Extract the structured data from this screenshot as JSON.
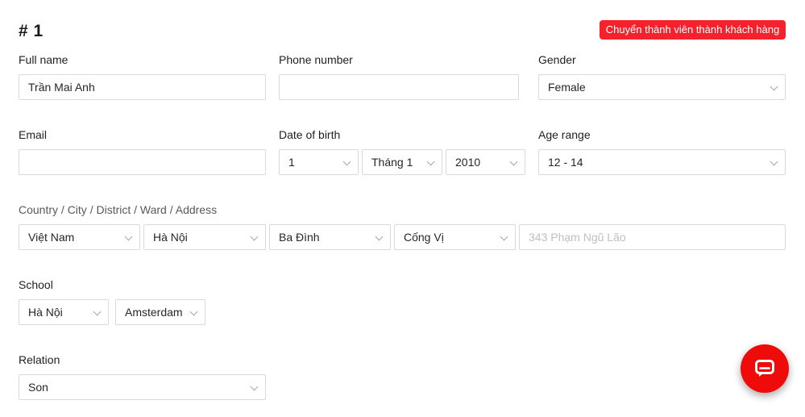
{
  "header": {
    "title": "# 1",
    "convert_label": "Chuyển thành viên thành khách hàng"
  },
  "form": {
    "full_name": {
      "label": "Full name",
      "value": "Trần Mai Anh"
    },
    "phone": {
      "label": "Phone number",
      "value": ""
    },
    "gender": {
      "label": "Gender",
      "value": "Female"
    },
    "email": {
      "label": "Email",
      "value": ""
    },
    "dob": {
      "label": "Date of birth",
      "day": "1",
      "month": "Tháng 1",
      "year": "2010"
    },
    "age_range": {
      "label": "Age range",
      "value": "12 - 14"
    },
    "address": {
      "label": "Country / City / District / Ward / Address",
      "country": "Việt Nam",
      "city": "Hà Nội",
      "district": "Ba Đình",
      "ward": "Cống Vị",
      "street_placeholder": "343 Phạm Ngũ Lão"
    },
    "school": {
      "label": "School",
      "city": "Hà Nội",
      "name": "Amsterdam"
    },
    "relation": {
      "label": "Relation",
      "value": "Son"
    }
  },
  "chat": {
    "icon": "chat-icon",
    "color": "#f00b0b"
  },
  "colors": {
    "danger": "#f5222d",
    "border": "#d9d9d9",
    "placeholder": "#bfbfbf"
  }
}
